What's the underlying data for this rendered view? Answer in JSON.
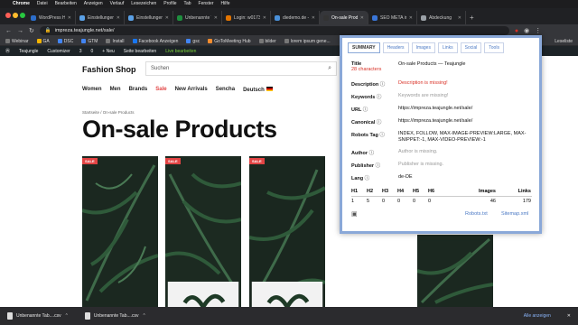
{
  "os_menu": {
    "apple": "",
    "items": [
      "Chrome",
      "Datei",
      "Bearbeiten",
      "Anzeigen",
      "Verlauf",
      "Lesezeichen",
      "Profile",
      "Tab",
      "Fenster",
      "Hilfe"
    ]
  },
  "tabs": [
    {
      "title": "WordPress Hostin",
      "color": "#2c6ecb"
    },
    {
      "title": "Einstellungen BC",
      "color": "#5aa0e6"
    },
    {
      "title": "Einstellungen BC",
      "color": "#5aa0e6"
    },
    {
      "title": "Unbenannte Tab",
      "color": "#1e8e3e"
    },
    {
      "title": "Login: w01730a",
      "color": "#e37400"
    },
    {
      "title": "diedemo.de - Ju",
      "color": "#4a90d9"
    },
    {
      "title": "On-sale Produkts",
      "color": "#333333",
      "active": true
    },
    {
      "title": "SEO META in 1 Cl",
      "color": "#3a76d8"
    },
    {
      "title": "Abdeckung",
      "color": "#9aa0a6"
    }
  ],
  "address": {
    "url": "impreza.teajungle.net/sale/"
  },
  "bookmarks": [
    "Webinar",
    "GA",
    "DSC",
    "GTM",
    "Install",
    "Facebook Anzeigen",
    "gsc",
    "GoToMeeting Hub",
    "bilder",
    "lorem ipsum gene..."
  ],
  "bookmarks_right": "Leseliste",
  "wp_admin": [
    "Teajungle",
    "Customizer",
    "3",
    "0",
    "+ Neu",
    "Seite bearbeiten",
    "Live bearbeiten"
  ],
  "site": {
    "logo": "Fashion Shop",
    "search_placeholder": "Suchen",
    "nav": [
      "Women",
      "Men",
      "Brands",
      "Sale",
      "New Arrivals",
      "Sencha",
      "Deutsch"
    ],
    "breadcrumb": "Startseite  /  On-sale Products",
    "title": "On-sale Products",
    "sale_badge": "SALE"
  },
  "seo_panel": {
    "tabs": [
      "SUMMARY",
      "Headers",
      "Images",
      "Links",
      "Social",
      "Tools"
    ],
    "title_label": "Title",
    "title_value": "On-sale Products — Teajungle",
    "title_chars": "28 characters",
    "description_label": "Description",
    "description_value": "Description is missing!",
    "keywords_label": "Keywords",
    "keywords_value": "Keywords are missing!",
    "url_label": "URL",
    "url_value": "https://impreza.teajungle.net/sale/",
    "canonical_label": "Canonical",
    "canonical_value": "https://impreza.teajungle.net/sale/",
    "robots_label": "Robots Tag",
    "robots_value": "INDEX, FOLLOW, MAX-IMAGE-PREVIEW:LARGE, MAX-SNIPPET:-1, MAX-VIDEO-PREVIEW:-1",
    "author_label": "Author",
    "author_value": "Author is missing.",
    "publisher_label": "Publisher",
    "publisher_value": "Publisher is missing.",
    "lang_label": "Lang",
    "lang_value": "de-DE",
    "headers": [
      "H1",
      "H2",
      "H3",
      "H4",
      "H5",
      "H6"
    ],
    "header_counts": [
      "1",
      "5",
      "0",
      "0",
      "0",
      "0"
    ],
    "images_label": "Images",
    "images_count": "46",
    "links_label": "Links",
    "links_count": "179",
    "robots_link": "Robots.txt",
    "sitemap_link": "Sitemap.xml"
  },
  "downloads": {
    "items": [
      "Unbenannte Tab....csv",
      "Unbenannte Tab....csv"
    ],
    "show_all": "Alle anzeigen"
  }
}
